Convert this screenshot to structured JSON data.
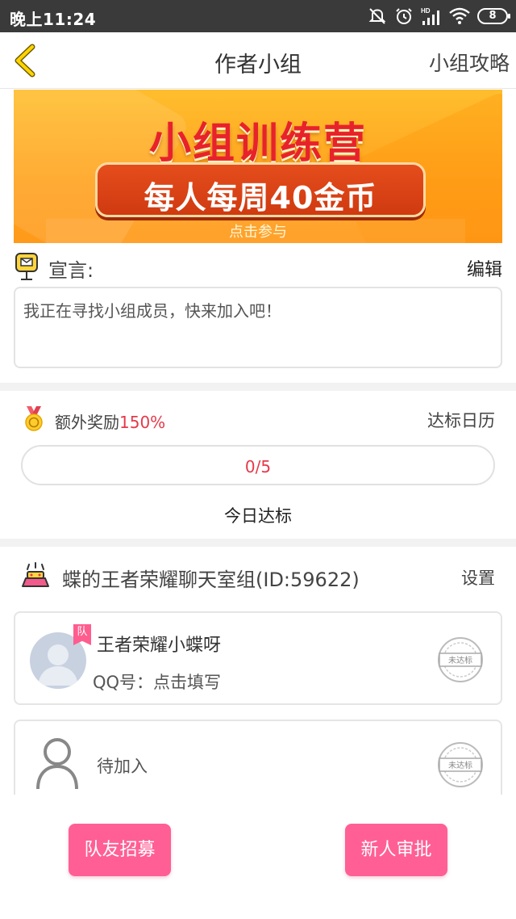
{
  "status_bar": {
    "time": "晚上11:24",
    "battery": "8"
  },
  "nav": {
    "title": "作者小组",
    "guide_label": "小组攻略"
  },
  "banner": {
    "headline": "小组训练营",
    "pill_text": "每人每周40金币",
    "cta": "点击参与"
  },
  "declaration": {
    "label": "宣言:",
    "edit_label": "编辑",
    "text": "我正在寻找小组成员，快来加入吧！"
  },
  "reward": {
    "prefix": "额外奖励",
    "percent": "150%",
    "calendar_label": "达标日历",
    "progress_text": "0/5",
    "progress_value": 0,
    "progress_max": 5,
    "today_label": "今日达标"
  },
  "group": {
    "name": "蝶的王者荣耀聊天室组(ID:59622)",
    "settings_label": "设置",
    "members": [
      {
        "tag": "队",
        "name": "王者荣耀小蝶呀",
        "qq": "QQ号：点击填写",
        "stamp": "未达标"
      },
      {
        "name": "待加入",
        "stamp": "未达标"
      }
    ]
  },
  "footer": {
    "recruit_label": "队友招募",
    "approve_label": "新人审批"
  },
  "colors": {
    "accent_pink": "#ff5f94",
    "highlight_red": "#e6394a",
    "banner_orange": "#ffa21e"
  }
}
